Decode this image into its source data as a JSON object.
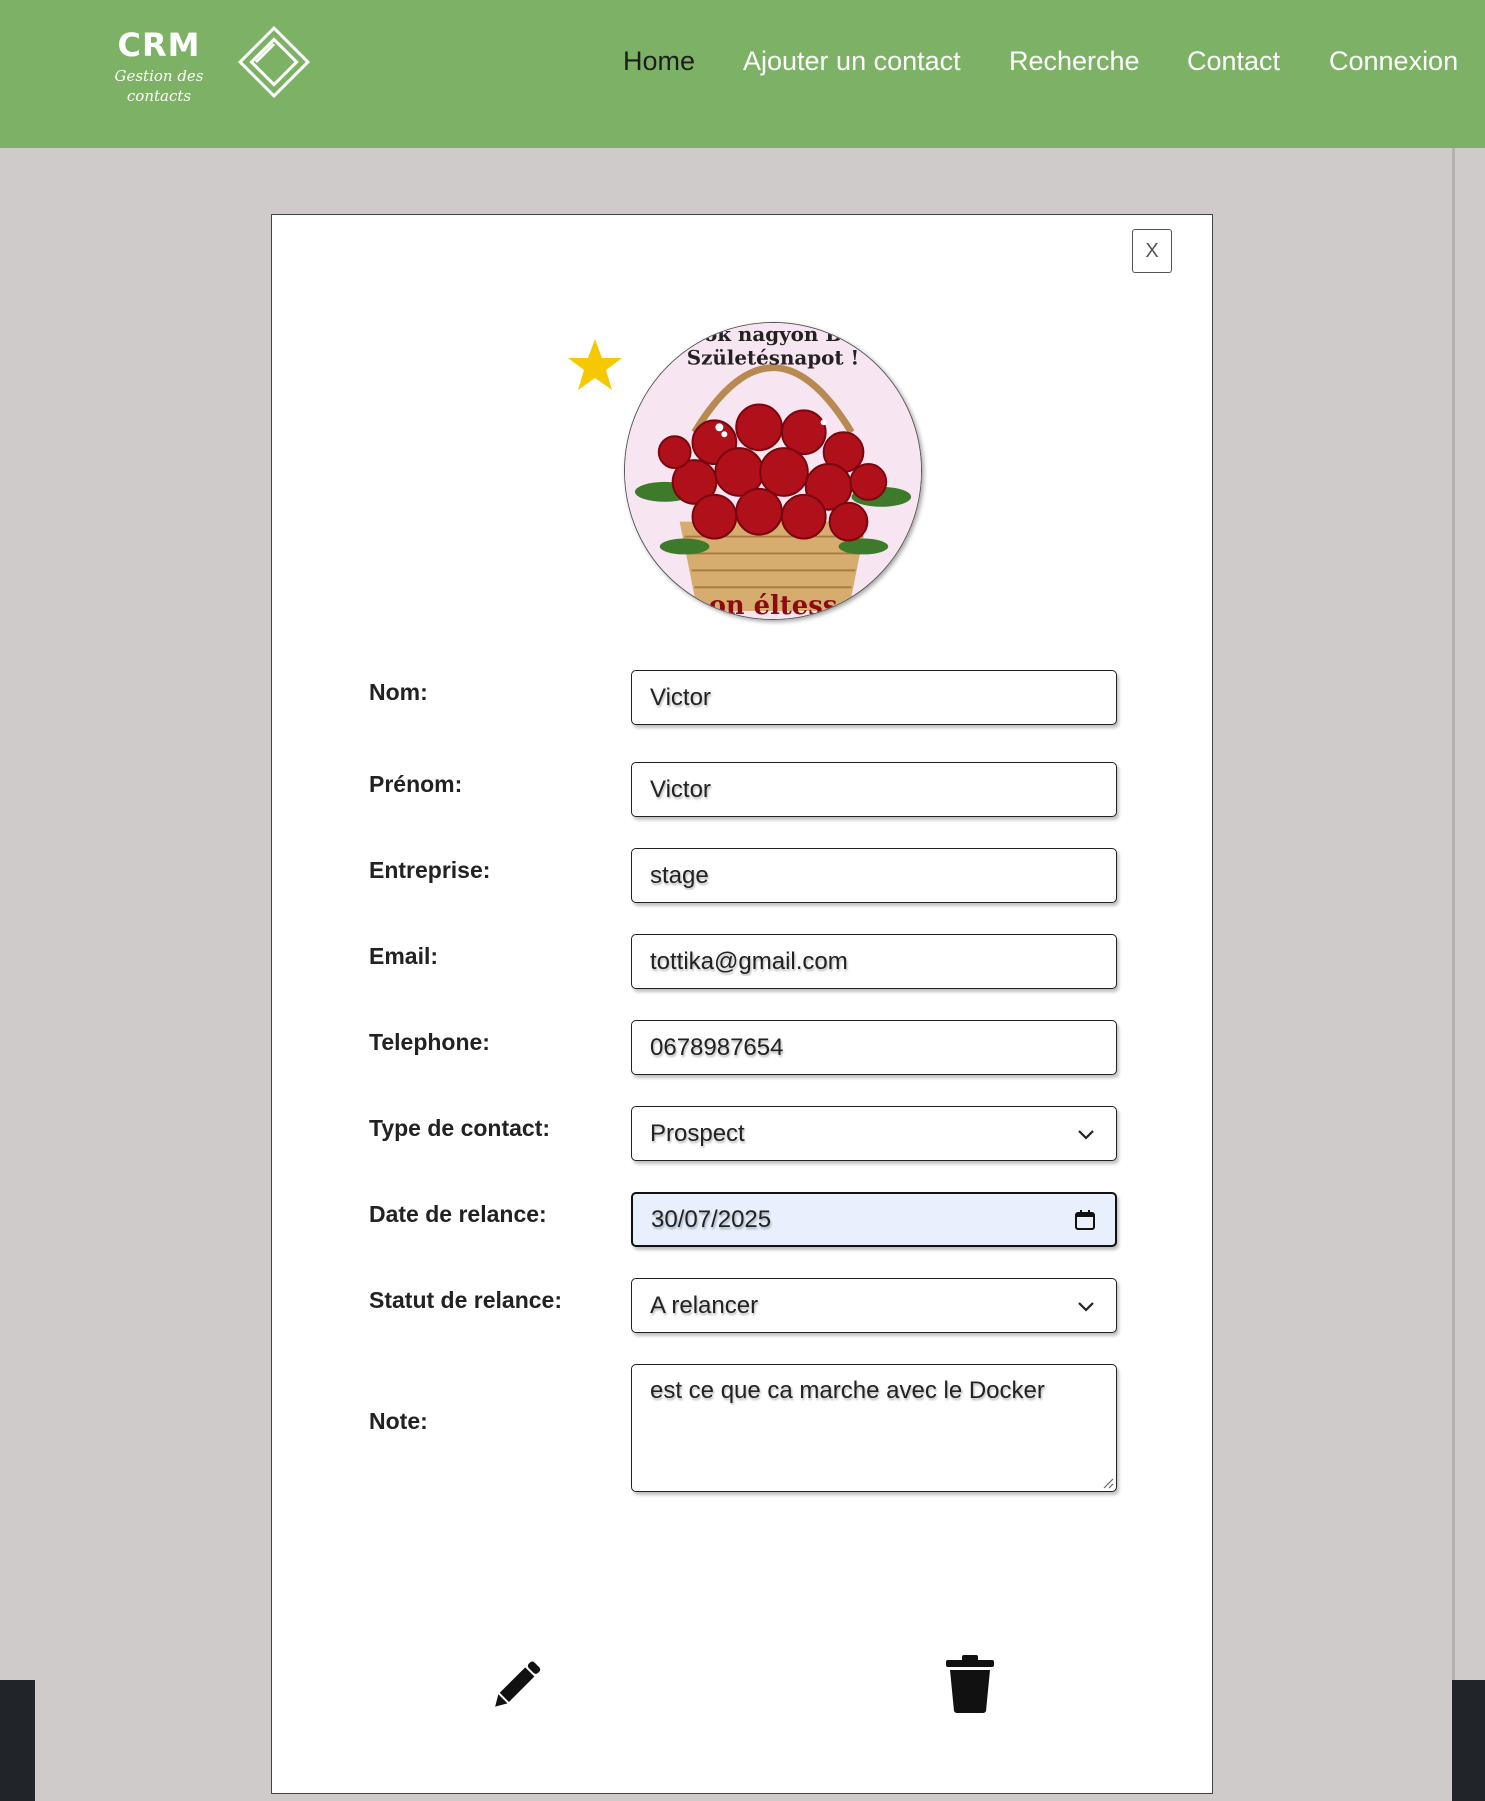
{
  "header": {
    "logo_title": "CRM",
    "logo_subtitle": "Gestion des contacts",
    "nav": [
      {
        "label": "Home",
        "active": true
      },
      {
        "label": "Ajouter un contact"
      },
      {
        "label": "Recherche"
      },
      {
        "label": "Contact"
      },
      {
        "label": "Connexion"
      }
    ]
  },
  "modal": {
    "close_label": "X",
    "favorite_icon": "star-icon",
    "favorite_color": "#f5c800",
    "avatar": {
      "caption_top_1": "ok nagyon B",
      "caption_top_2": "Születésnapot !",
      "caption_bottom": "on éltess"
    },
    "fields": {
      "nom": {
        "label": "Nom:",
        "value": "Victor"
      },
      "prenom": {
        "label": "Prénom:",
        "value": "Victor"
      },
      "entreprise": {
        "label": "Entreprise:",
        "value": "stage"
      },
      "email": {
        "label": "Email:",
        "value": "tottika@gmail.com"
      },
      "telephone": {
        "label": "Telephone:",
        "value": "0678987654"
      },
      "type": {
        "label": "Type de contact:",
        "value": "Prospect"
      },
      "date": {
        "label": "Date de relance:",
        "value": "30/07/2025"
      },
      "statut": {
        "label": "Statut de relance:",
        "value": "A relancer"
      },
      "note": {
        "label": "Note:",
        "value": "est ce que ca marche avec le Docker"
      }
    },
    "actions": {
      "edit_icon": "pencil-icon",
      "delete_icon": "trash-icon"
    }
  },
  "colors": {
    "navbar": "#7db266",
    "background": "#d0cbcb",
    "date_field": "#e8f0fe"
  }
}
